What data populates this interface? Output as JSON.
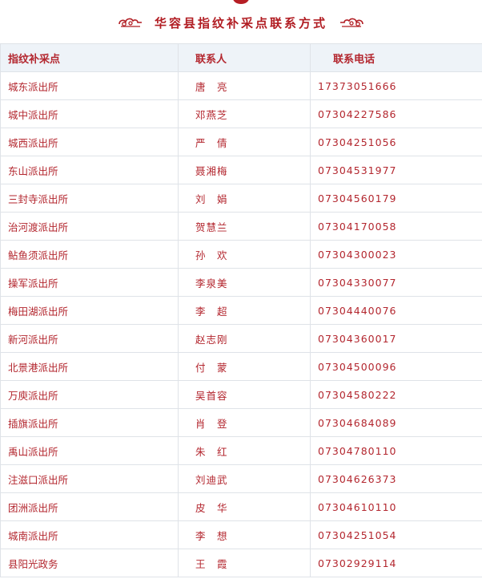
{
  "title": "华容县指纹补采点联系方式",
  "colors": {
    "accent": "#b11c22",
    "text": "#b3262e",
    "header_bg": "#eef3f8",
    "border": "#dfe3e8"
  },
  "ornaments": {
    "left": "cloud-ornament-icon",
    "right": "cloud-ornament-icon"
  },
  "table": {
    "headers": [
      "指纹补采点",
      "联系人",
      "联系电话"
    ],
    "rows": [
      [
        "城东派出所",
        "唐　亮",
        "17373051666"
      ],
      [
        "城中派出所",
        "邓燕芝",
        "07304227586"
      ],
      [
        "城西派出所",
        "严　倩",
        "07304251056"
      ],
      [
        "东山派出所",
        "聂湘梅",
        "07304531977"
      ],
      [
        "三封寺派出所",
        "刘　娟",
        "07304560179"
      ],
      [
        "治河渡派出所",
        "贺慧兰",
        "07304170058"
      ],
      [
        "鲇鱼须派出所",
        "孙　欢",
        "07304300023"
      ],
      [
        "操军派出所",
        "李泉美",
        "07304330077"
      ],
      [
        "梅田湖派出所",
        "李　超",
        "07304440076"
      ],
      [
        "新河派出所",
        "赵志刚",
        "07304360017"
      ],
      [
        "北景港派出所",
        "付　蒙",
        "07304500096"
      ],
      [
        "万庾派出所",
        "吴首容",
        "07304580222"
      ],
      [
        "插旗派出所",
        "肖　登",
        "07304684089"
      ],
      [
        "禹山派出所",
        "朱　红",
        "07304780110"
      ],
      [
        "注滋口派出所",
        "刘迪武",
        "07304626373"
      ],
      [
        "团洲派出所",
        "皮　华",
        "07304610110"
      ],
      [
        "城南派出所",
        "李　想",
        "07304251054"
      ],
      [
        "县阳光政务",
        "王　霞",
        "07302929114"
      ]
    ]
  }
}
